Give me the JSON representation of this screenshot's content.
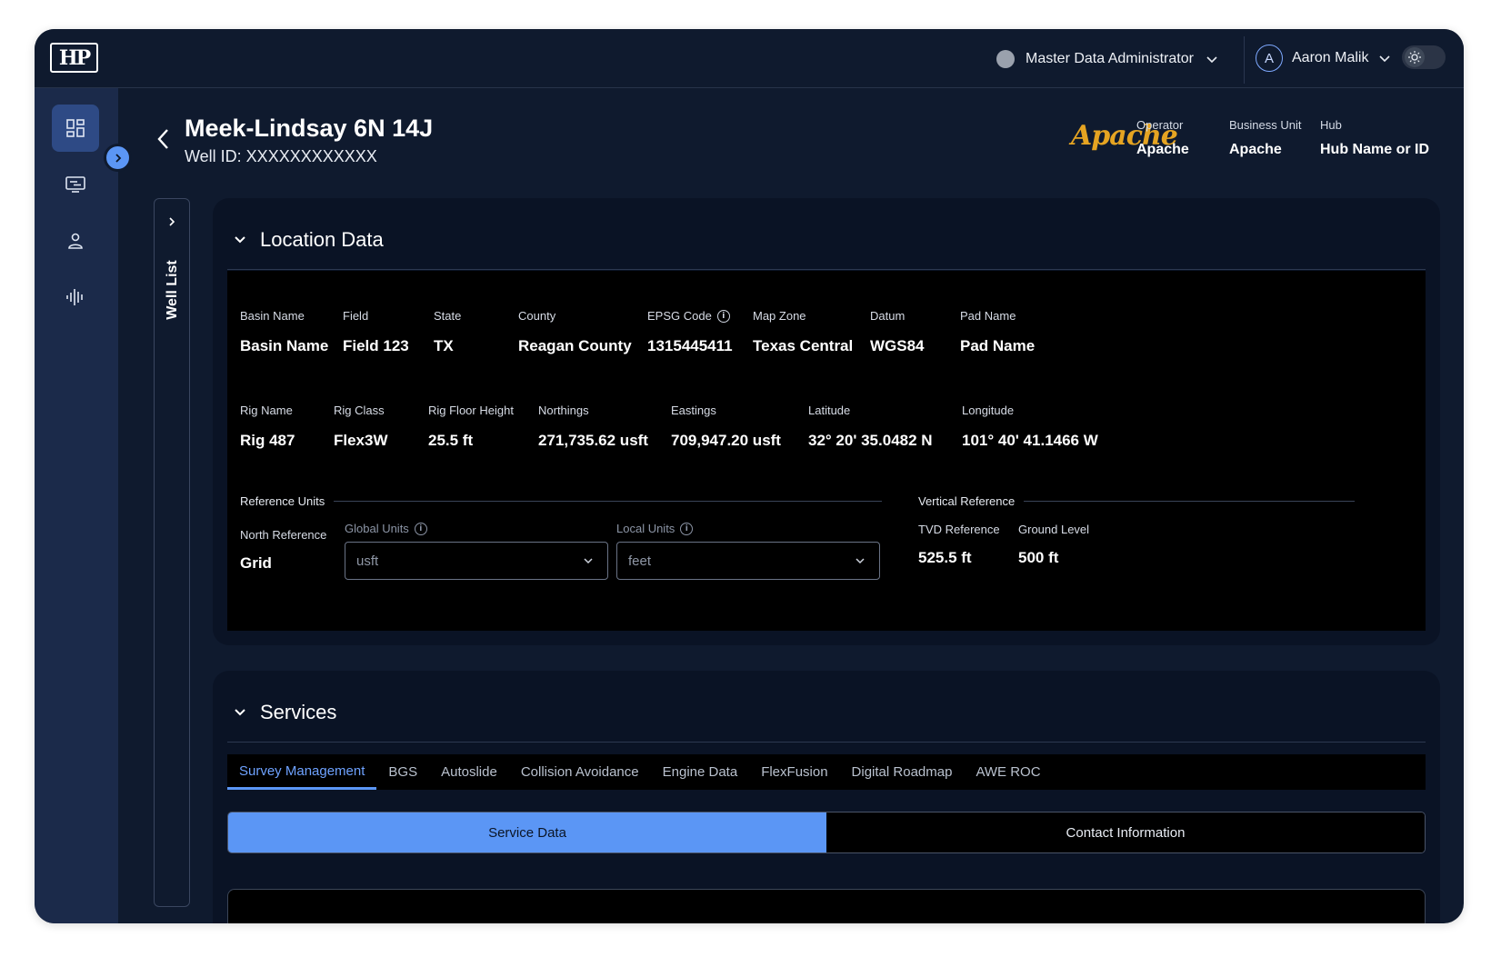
{
  "topbar": {
    "logo_text": "HP",
    "role": "Master Data Administrator",
    "user_initial": "A",
    "user_name": "Aaron Malik"
  },
  "header": {
    "title": "Meek-Lindsay 6N 14J",
    "well_id": "Well ID: XXXXXXXXXXXX",
    "operator_logo_text": "Apache",
    "meta": [
      {
        "label": "Operator",
        "value": "Apache"
      },
      {
        "label": "Business Unit",
        "value": "Apache"
      },
      {
        "label": "Hub",
        "value": "Hub Name or ID"
      }
    ]
  },
  "well_list": {
    "label": "Well List"
  },
  "location": {
    "title": "Location Data",
    "row1": [
      {
        "label": "Basin Name",
        "value": "Basin Name"
      },
      {
        "label": "Field",
        "value": "Field 123"
      },
      {
        "label": "State",
        "value": "TX"
      },
      {
        "label": "County",
        "value": "Reagan County"
      },
      {
        "label": "EPSG Code",
        "value": "1315445411"
      },
      {
        "label": "Map Zone",
        "value": "Texas Central"
      },
      {
        "label": "Datum",
        "value": "WGS84"
      },
      {
        "label": "Pad Name",
        "value": "Pad Name"
      }
    ],
    "row2": [
      {
        "label": "Rig Name",
        "value": "Rig 487"
      },
      {
        "label": "Rig Class",
        "value": "Flex3W"
      },
      {
        "label": "Rig Floor Height",
        "value": "25.5 ft"
      },
      {
        "label": "Northings",
        "value": "271,735.62 usft"
      },
      {
        "label": "Eastings",
        "value": "709,947.20 usft"
      },
      {
        "label": "Latitude",
        "value": "32° 20' 35.0482 N"
      },
      {
        "label": "Longitude",
        "value": "101° 40' 41.1466 W"
      }
    ],
    "reference_units": {
      "title": "Reference Units",
      "north_reference_label": "North Reference",
      "north_reference_value": "Grid",
      "global_units_label": "Global Units",
      "global_units_value": "usft",
      "local_units_label": "Local Units",
      "local_units_value": "feet"
    },
    "vertical_reference": {
      "title": "Vertical Reference",
      "tvd_label": "TVD Reference",
      "tvd_value": "525.5 ft",
      "ground_label": "Ground Level",
      "ground_value": "500 ft"
    }
  },
  "services": {
    "title": "Services",
    "tabs": [
      "Survey Management",
      "BGS",
      "Autoslide",
      "Collision Avoidance",
      "Engine Data",
      "FlexFusion",
      "Digital Roadmap",
      "AWE ROC"
    ],
    "active_tab": "Survey Management",
    "segments": [
      "Service Data",
      "Contact Information"
    ],
    "active_segment": "Service Data"
  },
  "colors": {
    "app_bg": "#0f1a2e",
    "rail_bg": "#1b2a4a",
    "accent": "#5b96f5",
    "operator_logo": "#e5a422"
  }
}
